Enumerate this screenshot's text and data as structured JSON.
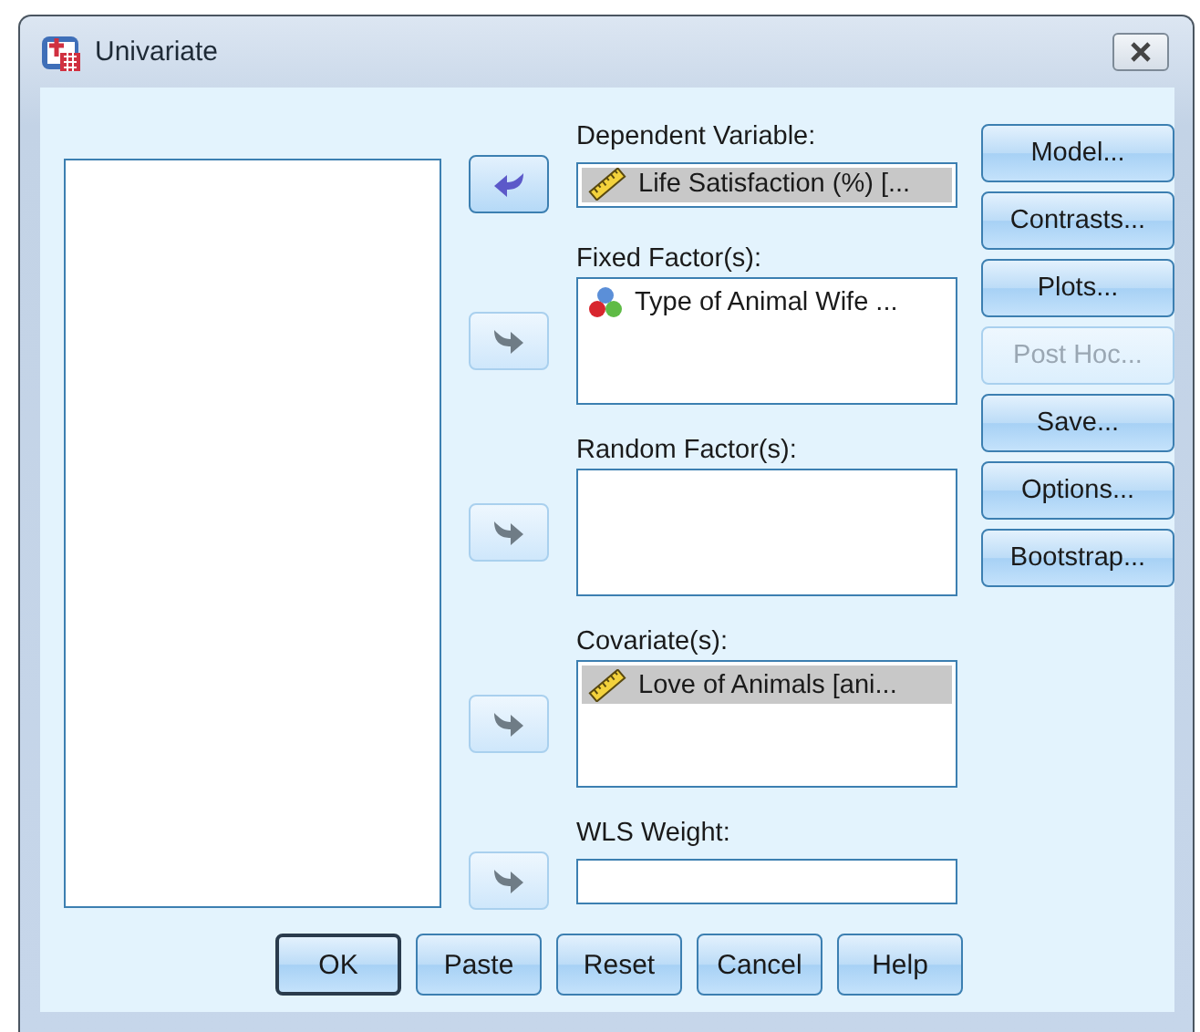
{
  "window": {
    "title": "Univariate"
  },
  "targets": [
    {
      "kind": "single",
      "label": "Dependent Variable:",
      "arrow": {
        "kind": "left",
        "disabled": false
      },
      "items": [
        {
          "text": "Life Satisfaction (%) [...",
          "kind": "scale",
          "selected": true
        }
      ]
    },
    {
      "kind": "list",
      "label": "Fixed Factor(s):",
      "arrow": {
        "kind": "right",
        "disabled": true
      },
      "items": [
        {
          "text": "Type of Animal Wife ...",
          "kind": "nominal",
          "selected": false
        }
      ]
    },
    {
      "kind": "list",
      "label": "Random Factor(s):",
      "arrow": {
        "kind": "right",
        "disabled": true
      }
    },
    {
      "kind": "list",
      "label": "Covariate(s):",
      "arrow": {
        "kind": "right",
        "disabled": true
      },
      "items": [
        {
          "text": "Love of Animals [ani...",
          "kind": "scale",
          "selected": true
        }
      ]
    },
    {
      "kind": "single",
      "label": "WLS Weight:",
      "arrow": {
        "kind": "right",
        "disabled": true
      }
    }
  ],
  "side_buttons": [
    {
      "label": "Model...",
      "disabled": false
    },
    {
      "label": "Contrasts...",
      "disabled": false
    },
    {
      "label": "Plots...",
      "disabled": false
    },
    {
      "label": "Post Hoc...",
      "disabled": true
    },
    {
      "label": "Save...",
      "disabled": false
    },
    {
      "label": "Options...",
      "disabled": false
    },
    {
      "label": "Bootstrap...",
      "disabled": false
    }
  ],
  "bottom_buttons": [
    {
      "label": "OK",
      "default": true
    },
    {
      "label": "Paste",
      "default": false
    },
    {
      "label": "Reset",
      "default": false
    },
    {
      "label": "Cancel",
      "default": false
    },
    {
      "label": "Help",
      "default": false
    }
  ]
}
